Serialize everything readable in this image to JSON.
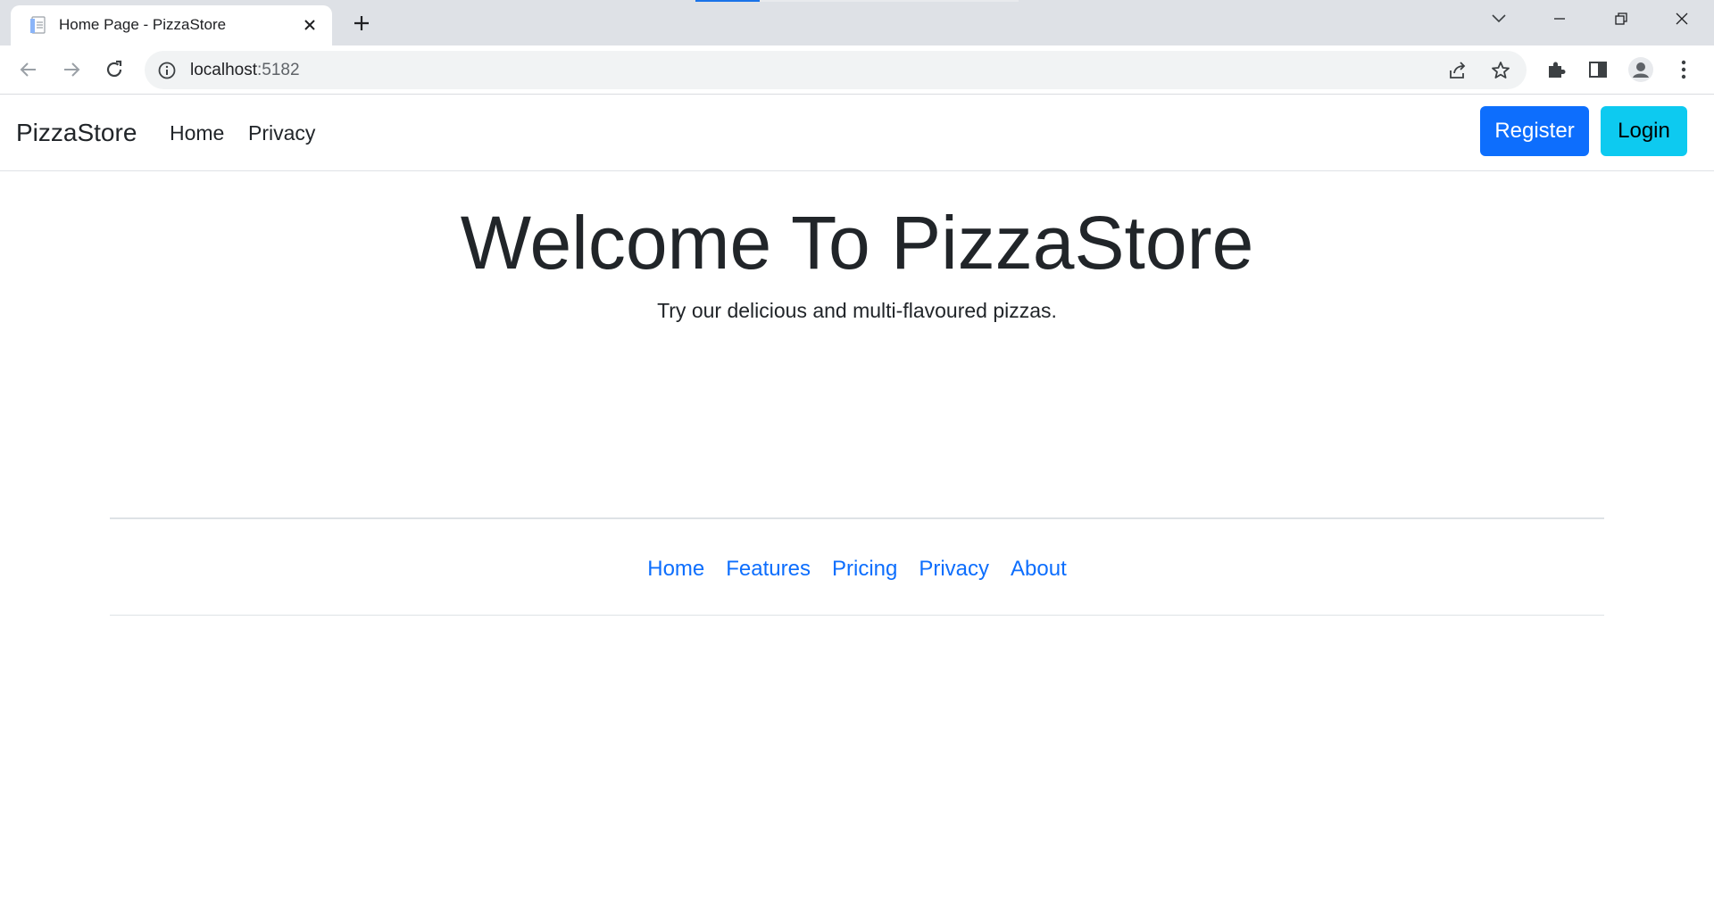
{
  "browser": {
    "tab_title": "Home Page - PizzaStore",
    "url_host": "localhost",
    "url_port": ":5182"
  },
  "navbar": {
    "brand": "PizzaStore",
    "links": [
      "Home",
      "Privacy"
    ],
    "register_label": "Register",
    "login_label": "Login"
  },
  "hero": {
    "title": "Welcome To PizzaStore",
    "subtitle": "Try our delicious and multi-flavoured pizzas."
  },
  "footer": {
    "links": [
      "Home",
      "Features",
      "Pricing",
      "Privacy",
      "About"
    ]
  },
  "colors": {
    "primary": "#0d6efd",
    "info": "#0dcaf0",
    "text": "#212529",
    "chrome_bg": "#dee1e6"
  }
}
